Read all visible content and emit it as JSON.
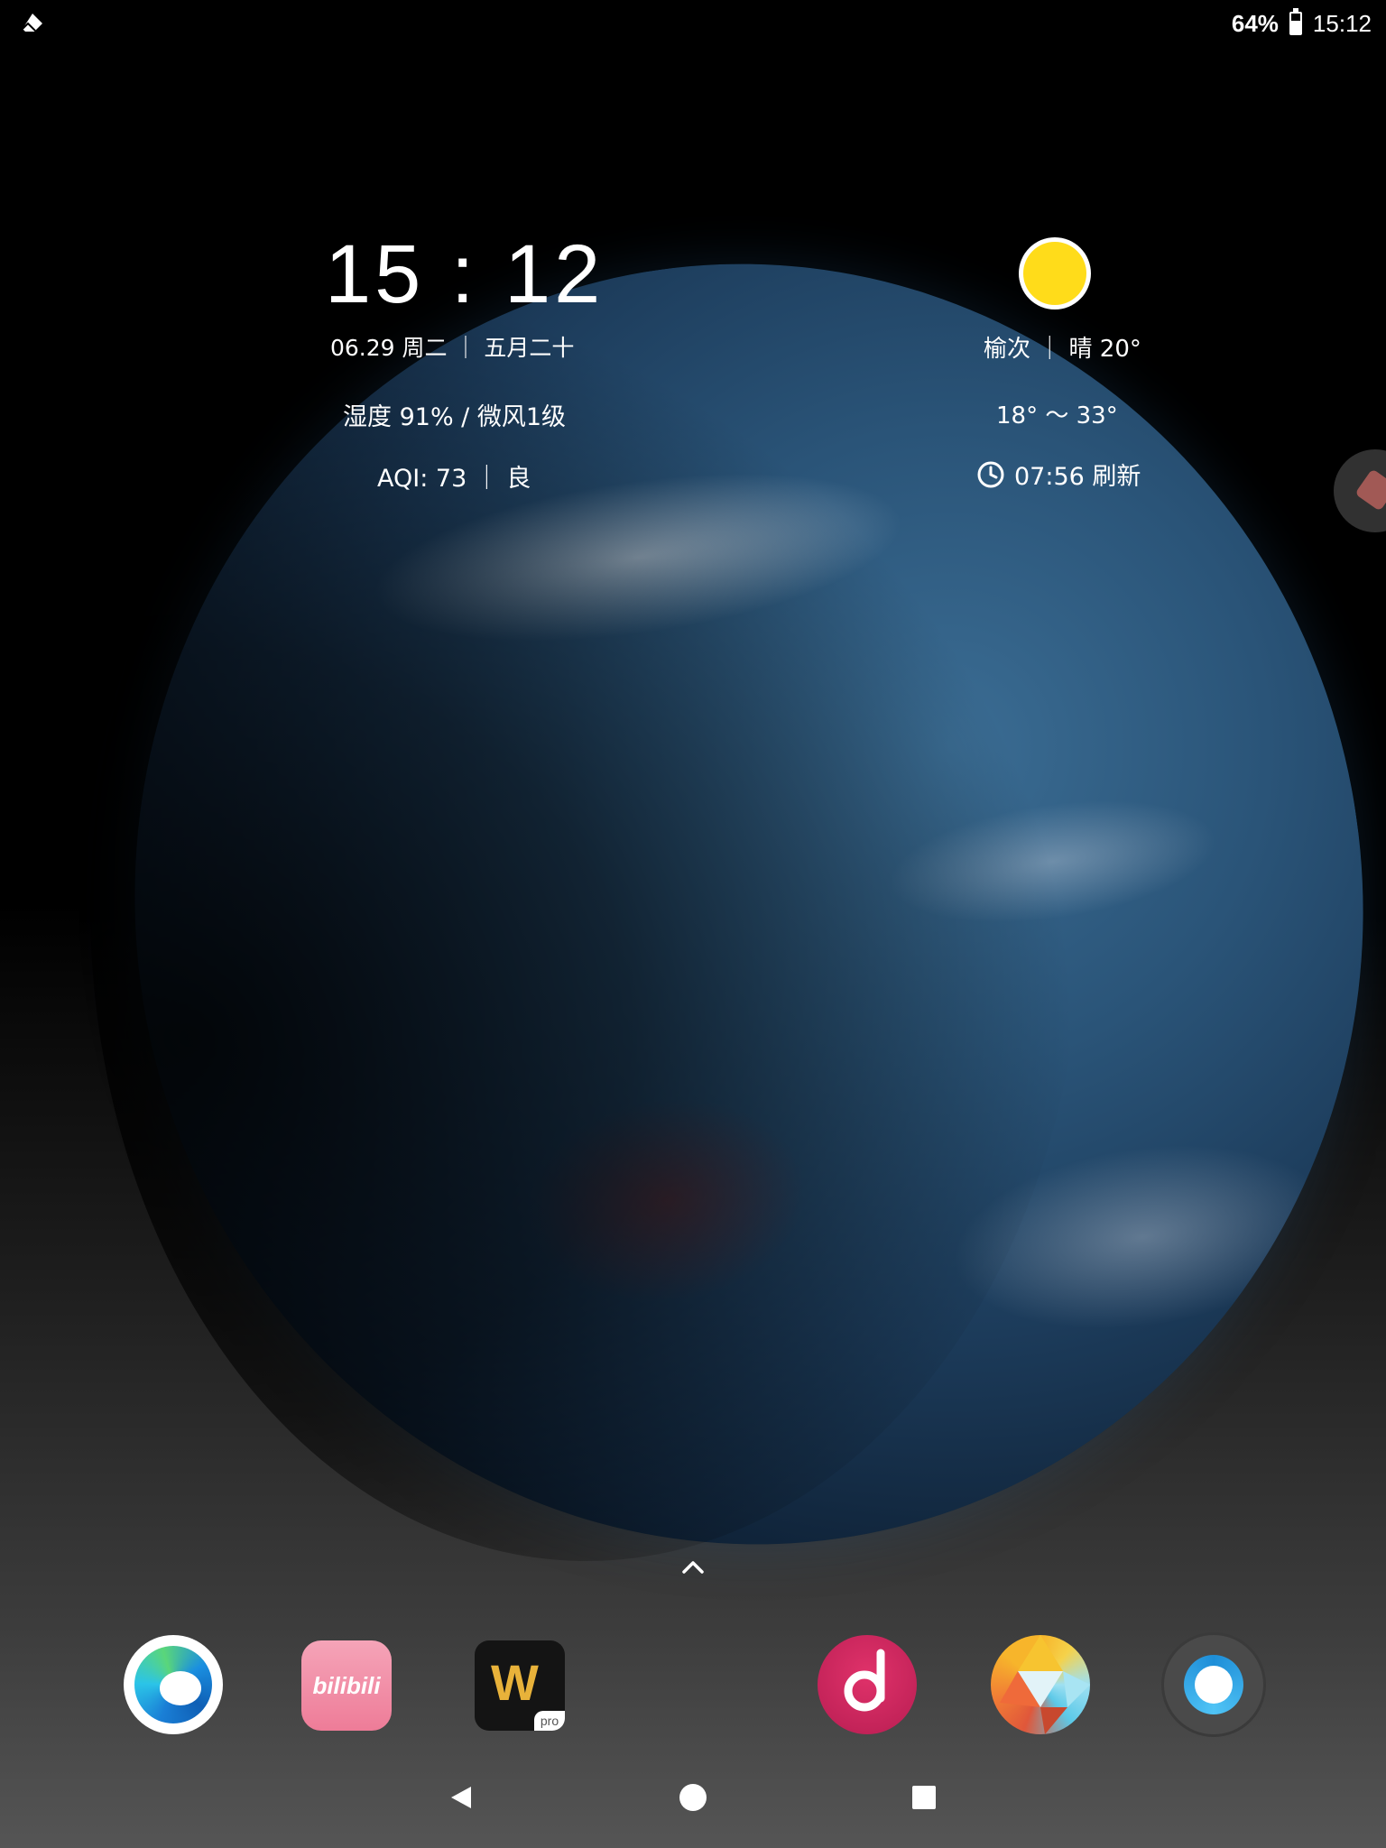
{
  "status_bar": {
    "notification_icon": "eraser-icon",
    "battery_percent": "64%",
    "battery_level": 0.64,
    "time": "15:12"
  },
  "clock_widget": {
    "time": "15 : 12",
    "date": "06.29  周二 ｜ 五月二十",
    "humidity": "湿度 91% / 微风1级",
    "aqi": "AQI:  73  ｜ 良"
  },
  "weather_widget": {
    "condition_icon": "sun-icon",
    "location_condition": "榆次 ｜ 晴  20°",
    "temp_range": "18° ～ 33°",
    "refresh": "07:56 刷新"
  },
  "dock": {
    "apps": [
      {
        "name": "Microsoft Edge",
        "icon": "edge-icon"
      },
      {
        "name": "bilibili",
        "icon": "bilibili-icon",
        "logo_text": "bilibili"
      },
      {
        "name": "WPS Office Pro",
        "icon": "wps-icon",
        "badge": "pro"
      },
      {
        "name": "Music",
        "icon": "music-icon"
      },
      {
        "name": "Gallery",
        "icon": "gallery-icon"
      },
      {
        "name": "Camera",
        "icon": "camera-icon"
      }
    ]
  },
  "navigation": {
    "back": "back-icon",
    "home": "home-icon",
    "recents": "recents-icon"
  },
  "colors": {
    "sun": "#ffdc1a",
    "bilibili_pink": "#ee7c98",
    "music_red": "#b81d52"
  }
}
